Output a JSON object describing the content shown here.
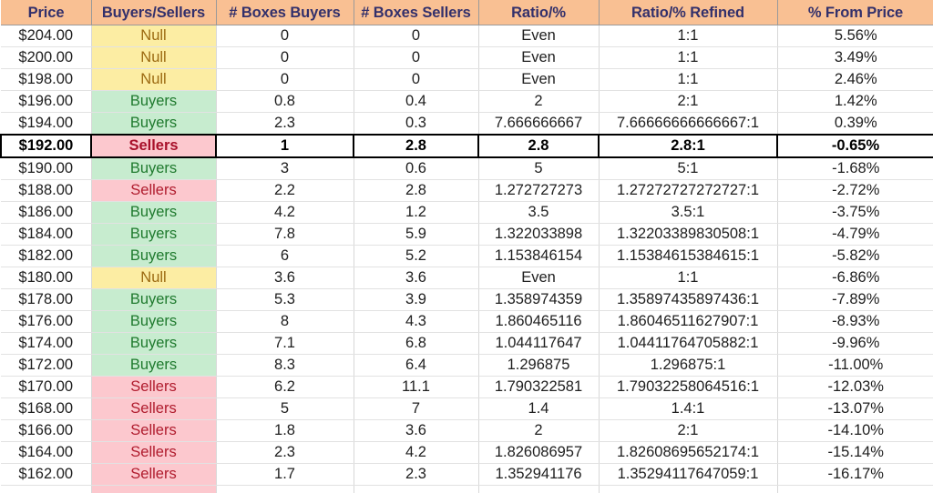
{
  "table": {
    "columns": [
      "Price",
      "Buyers/Sellers",
      "# Boxes Buyers",
      "# Boxes Sellers",
      "Ratio/%",
      "Ratio/% Refined",
      "% From Price"
    ],
    "colors": {
      "header_fill": "#f9c093",
      "header_text": "#33306b",
      "buyers_fill": "#c7eccf",
      "buyers_text": "#1f7a2e",
      "sellers_fill": "#fcc8ce",
      "sellers_text": "#b01c2e",
      "null_fill": "#fceda3",
      "null_text": "#9c6a12",
      "highlight_border": "#000000",
      "gridline": "#d8d8d8"
    },
    "rows": [
      {
        "price": "$204.00",
        "status": "Null",
        "boxes_buyers": "0",
        "boxes_sellers": "0",
        "ratio": "Even",
        "ratio_refined": "1:1",
        "pct_from_price": "5.56%",
        "highlight": false
      },
      {
        "price": "$200.00",
        "status": "Null",
        "boxes_buyers": "0",
        "boxes_sellers": "0",
        "ratio": "Even",
        "ratio_refined": "1:1",
        "pct_from_price": "3.49%",
        "highlight": false
      },
      {
        "price": "$198.00",
        "status": "Null",
        "boxes_buyers": "0",
        "boxes_sellers": "0",
        "ratio": "Even",
        "ratio_refined": "1:1",
        "pct_from_price": "2.46%",
        "highlight": false
      },
      {
        "price": "$196.00",
        "status": "Buyers",
        "boxes_buyers": "0.8",
        "boxes_sellers": "0.4",
        "ratio": "2",
        "ratio_refined": "2:1",
        "pct_from_price": "1.42%",
        "highlight": false
      },
      {
        "price": "$194.00",
        "status": "Buyers",
        "boxes_buyers": "2.3",
        "boxes_sellers": "0.3",
        "ratio": "7.666666667",
        "ratio_refined": "7.66666666666667:1",
        "pct_from_price": "0.39%",
        "highlight": false
      },
      {
        "price": "$192.00",
        "status": "Sellers",
        "boxes_buyers": "1",
        "boxes_sellers": "2.8",
        "ratio": "2.8",
        "ratio_refined": "2.8:1",
        "pct_from_price": "-0.65%",
        "highlight": true
      },
      {
        "price": "$190.00",
        "status": "Buyers",
        "boxes_buyers": "3",
        "boxes_sellers": "0.6",
        "ratio": "5",
        "ratio_refined": "5:1",
        "pct_from_price": "-1.68%",
        "highlight": false
      },
      {
        "price": "$188.00",
        "status": "Sellers",
        "boxes_buyers": "2.2",
        "boxes_sellers": "2.8",
        "ratio": "1.272727273",
        "ratio_refined": "1.27272727272727:1",
        "pct_from_price": "-2.72%",
        "highlight": false
      },
      {
        "price": "$186.00",
        "status": "Buyers",
        "boxes_buyers": "4.2",
        "boxes_sellers": "1.2",
        "ratio": "3.5",
        "ratio_refined": "3.5:1",
        "pct_from_price": "-3.75%",
        "highlight": false
      },
      {
        "price": "$184.00",
        "status": "Buyers",
        "boxes_buyers": "7.8",
        "boxes_sellers": "5.9",
        "ratio": "1.322033898",
        "ratio_refined": "1.32203389830508:1",
        "pct_from_price": "-4.79%",
        "highlight": false
      },
      {
        "price": "$182.00",
        "status": "Buyers",
        "boxes_buyers": "6",
        "boxes_sellers": "5.2",
        "ratio": "1.153846154",
        "ratio_refined": "1.15384615384615:1",
        "pct_from_price": "-5.82%",
        "highlight": false
      },
      {
        "price": "$180.00",
        "status": "Null",
        "boxes_buyers": "3.6",
        "boxes_sellers": "3.6",
        "ratio": "Even",
        "ratio_refined": "1:1",
        "pct_from_price": "-6.86%",
        "highlight": false
      },
      {
        "price": "$178.00",
        "status": "Buyers",
        "boxes_buyers": "5.3",
        "boxes_sellers": "3.9",
        "ratio": "1.358974359",
        "ratio_refined": "1.35897435897436:1",
        "pct_from_price": "-7.89%",
        "highlight": false
      },
      {
        "price": "$176.00",
        "status": "Buyers",
        "boxes_buyers": "8",
        "boxes_sellers": "4.3",
        "ratio": "1.860465116",
        "ratio_refined": "1.86046511627907:1",
        "pct_from_price": "-8.93%",
        "highlight": false
      },
      {
        "price": "$174.00",
        "status": "Buyers",
        "boxes_buyers": "7.1",
        "boxes_sellers": "6.8",
        "ratio": "1.044117647",
        "ratio_refined": "1.04411764705882:1",
        "pct_from_price": "-9.96%",
        "highlight": false
      },
      {
        "price": "$172.00",
        "status": "Buyers",
        "boxes_buyers": "8.3",
        "boxes_sellers": "6.4",
        "ratio": "1.296875",
        "ratio_refined": "1.296875:1",
        "pct_from_price": "-11.00%",
        "highlight": false
      },
      {
        "price": "$170.00",
        "status": "Sellers",
        "boxes_buyers": "6.2",
        "boxes_sellers": "11.1",
        "ratio": "1.790322581",
        "ratio_refined": "1.79032258064516:1",
        "pct_from_price": "-12.03%",
        "highlight": false
      },
      {
        "price": "$168.00",
        "status": "Sellers",
        "boxes_buyers": "5",
        "boxes_sellers": "7",
        "ratio": "1.4",
        "ratio_refined": "1.4:1",
        "pct_from_price": "-13.07%",
        "highlight": false
      },
      {
        "price": "$166.00",
        "status": "Sellers",
        "boxes_buyers": "1.8",
        "boxes_sellers": "3.6",
        "ratio": "2",
        "ratio_refined": "2:1",
        "pct_from_price": "-14.10%",
        "highlight": false
      },
      {
        "price": "$164.00",
        "status": "Sellers",
        "boxes_buyers": "2.3",
        "boxes_sellers": "4.2",
        "ratio": "1.826086957",
        "ratio_refined": "1.82608695652174:1",
        "pct_from_price": "-15.14%",
        "highlight": false
      },
      {
        "price": "$162.00",
        "status": "Sellers",
        "boxes_buyers": "1.7",
        "boxes_sellers": "2.3",
        "ratio": "1.352941176",
        "ratio_refined": "1.35294117647059:1",
        "pct_from_price": "-16.17%",
        "highlight": false
      }
    ]
  }
}
